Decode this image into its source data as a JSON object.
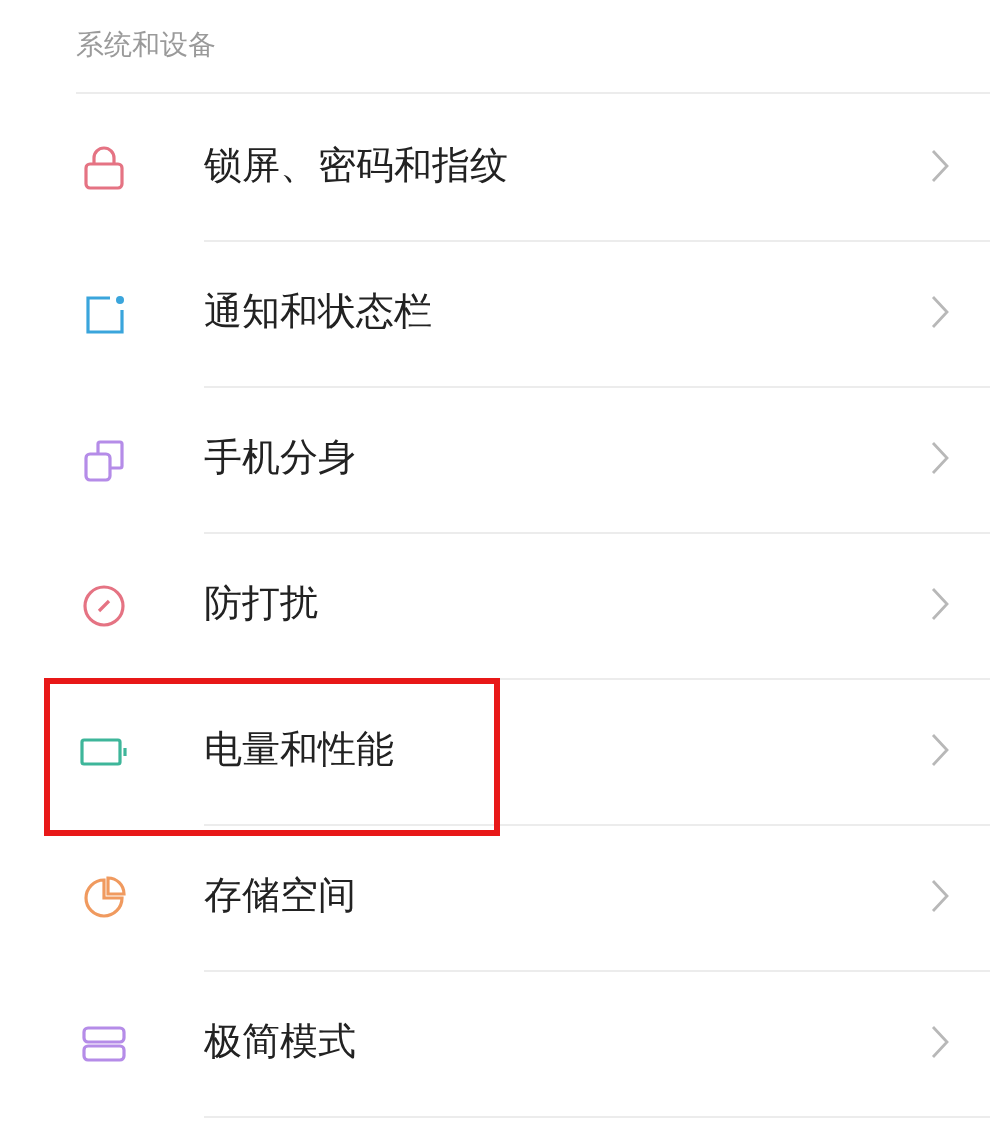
{
  "section_title": "系统和设备",
  "items": [
    {
      "kind": "lock",
      "label": "锁屏、密码和指纹",
      "highlighted": false
    },
    {
      "kind": "notification",
      "label": "通知和状态栏",
      "highlighted": false
    },
    {
      "kind": "clone",
      "label": "手机分身",
      "highlighted": false
    },
    {
      "kind": "dnd",
      "label": "防打扰",
      "highlighted": false
    },
    {
      "kind": "battery",
      "label": "电量和性能",
      "highlighted": true
    },
    {
      "kind": "storage",
      "label": "存储空间",
      "highlighted": false
    },
    {
      "kind": "simple",
      "label": "极简模式",
      "highlighted": false
    }
  ]
}
